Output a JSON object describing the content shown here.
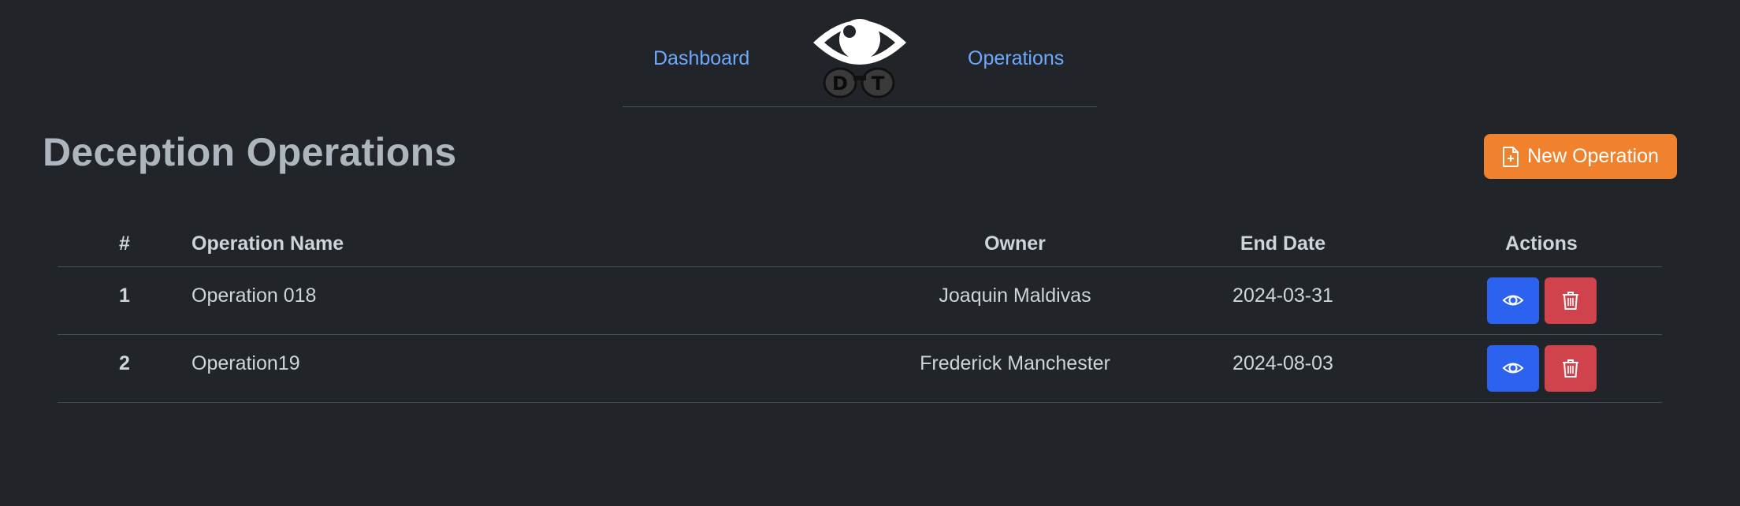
{
  "nav": {
    "dashboard_label": "Dashboard",
    "operations_label": "Operations",
    "logo_text": "DT"
  },
  "page": {
    "title": "Deception Operations",
    "new_button_label": "New Operation"
  },
  "table": {
    "headers": [
      "#",
      "Operation Name",
      "Owner",
      "End Date",
      "Actions"
    ],
    "rows": [
      {
        "num": "1",
        "name": "Operation 018",
        "owner": "Joaquin Maldivas",
        "end_date": "2024-03-31"
      },
      {
        "num": "2",
        "name": "Operation19",
        "owner": "Frederick Manchester",
        "end_date": "2024-08-03"
      }
    ]
  },
  "colors": {
    "background": "#212529",
    "link": "#6ea8fe",
    "accent_orange": "#f0812d",
    "view_blue": "#2b63f0",
    "delete_red": "#d1434c"
  },
  "icons": [
    "eye-logo-icon",
    "file-plus-icon",
    "eye-icon",
    "trash-icon"
  ]
}
